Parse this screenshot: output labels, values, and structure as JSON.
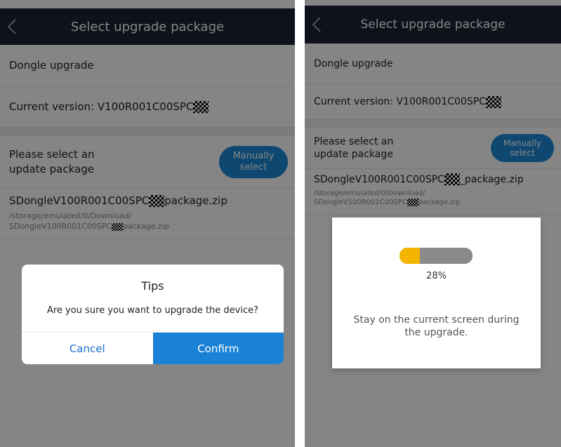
{
  "screens": [
    {
      "header": {
        "title": "Select upgrade package"
      },
      "rows": {
        "dongle": "Dongle upgrade",
        "current_version_prefix": "Current version: V100R001C00SPC"
      },
      "select": {
        "label_line1": "Please select an",
        "label_line2": "update package",
        "button_line1": "Manually",
        "button_line2": "select"
      },
      "package": {
        "name_prefix": "SDongleV100R001C00SPC",
        "name_suffix": "package.zip",
        "path_line1": "/storage/emulated/0/Download/",
        "path_line2_prefix": "SDongleV100R001C00SPC",
        "path_line2_suffix": "package.zip"
      },
      "dialog": {
        "title": "Tips",
        "message": "Are you sure you want to upgrade the device?",
        "cancel": "Cancel",
        "confirm": "Confirm"
      }
    },
    {
      "header": {
        "title": "Select upgrade package"
      },
      "rows": {
        "dongle": "Dongle upgrade",
        "current_version_prefix": "Current version: V100R001C00SPC"
      },
      "select": {
        "label_line1": "Please select an",
        "label_line2": "update package",
        "button_line1": "Manually",
        "button_line2": "select"
      },
      "package": {
        "name_prefix": "SDongleV100R001C00SPC",
        "name_suffix": "_package.zip",
        "path_line1": "/storage/emulated/0/Download/",
        "path_line2_prefix": "SDongleV100R001C00SPC",
        "path_line2_suffix": "package.zip"
      },
      "progress": {
        "percent_text": "28%",
        "percent_value": 0.28,
        "message": "Stay on the current screen during the upgrade."
      }
    }
  ],
  "colors": {
    "header": "#1b2433",
    "accent": "#1a82d6",
    "progress_fill": "#f5b400",
    "progress_track": "#8a8a8a"
  },
  "icons": {
    "back": "chevron-left-icon",
    "redaction": "checkerboard-redaction"
  }
}
